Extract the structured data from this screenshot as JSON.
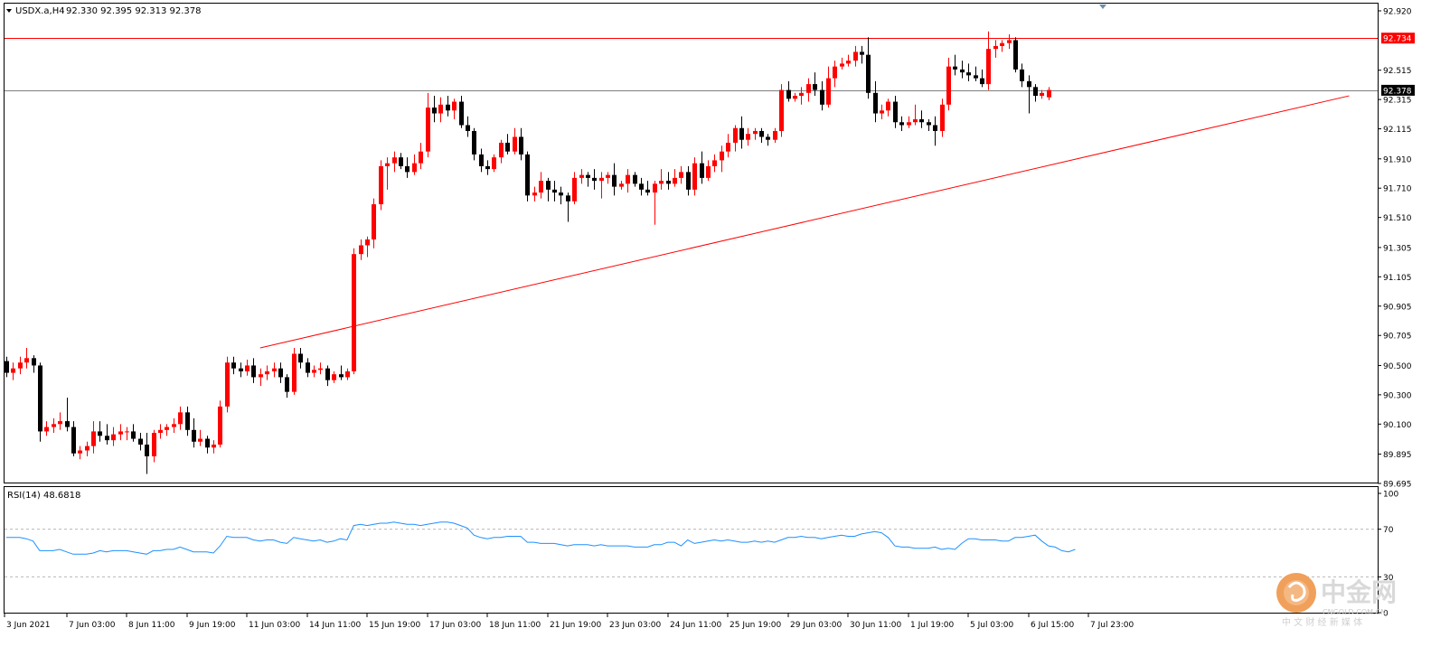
{
  "chart_header": {
    "symbol_timeframe": "USDX.a,H4",
    "ohlc": "92.330 92.395 92.313 92.378"
  },
  "rsi_label": "RSI(14) 48.6818",
  "price_axis": {
    "ticks": [
      "92.920",
      "92.515",
      "92.315",
      "92.115",
      "91.910",
      "91.710",
      "91.510",
      "91.305",
      "91.105",
      "90.905",
      "90.705",
      "90.500",
      "90.300",
      "90.100",
      "89.895",
      "89.695"
    ],
    "marker_red": "92.734",
    "marker_current": "92.378"
  },
  "rsi_axis": {
    "ticks": [
      "100",
      "70",
      "30",
      "0"
    ]
  },
  "time_axis": {
    "labels": [
      "3 Jun 2021",
      "7 Jun 03:00",
      "8 Jun 11:00",
      "9 Jun 19:00",
      "11 Jun 03:00",
      "14 Jun 11:00",
      "15 Jun 19:00",
      "17 Jun 03:00",
      "18 Jun 11:00",
      "21 Jun 19:00",
      "23 Jun 03:00",
      "24 Jun 11:00",
      "25 Jun 19:00",
      "29 Jun 03:00",
      "30 Jun 11:00",
      "1 Jul 19:00",
      "5 Jul 03:00",
      "6 Jul 15:00",
      "7 Jul 23:00"
    ]
  },
  "watermark": {
    "chinese": "中金网",
    "domain": "CNGOLD.COM.CN",
    "tagline": "中 文 财 经 新 媒 体"
  },
  "colors": {
    "bull": "#ff0000",
    "bear": "#000000",
    "trendline": "#ff0000",
    "rsi_line": "#1e90ff",
    "logo_orange": "#f0a05a"
  },
  "chart_data": {
    "type": "candlestick",
    "symbol": "USDX.a",
    "timeframe": "H4",
    "ylim": [
      89.695,
      92.92
    ],
    "rsi_ylim": [
      0,
      100
    ],
    "rsi_levels": [
      70,
      30
    ],
    "horizontal_lines": [
      {
        "price": 92.734,
        "color": "#ff0000"
      },
      {
        "price": 92.378,
        "color": "#808080"
      }
    ],
    "trendline": [
      {
        "x_index": 38,
        "price": 90.62
      },
      {
        "x_index": 201,
        "price": 92.34
      }
    ],
    "candles": [
      [
        90.53,
        90.56,
        90.42,
        90.45
      ],
      [
        90.45,
        90.52,
        90.4,
        90.48
      ],
      [
        90.48,
        90.56,
        90.44,
        90.52
      ],
      [
        90.52,
        90.62,
        90.48,
        90.55
      ],
      [
        90.55,
        90.57,
        90.45,
        90.5
      ],
      [
        90.5,
        90.52,
        89.98,
        90.05
      ],
      [
        90.05,
        90.12,
        90.02,
        90.08
      ],
      [
        90.08,
        90.14,
        90.04,
        90.1
      ],
      [
        90.1,
        90.18,
        90.06,
        90.12
      ],
      [
        90.12,
        90.28,
        90.05,
        90.08
      ],
      [
        90.08,
        90.12,
        89.88,
        89.9
      ],
      [
        89.9,
        89.95,
        89.86,
        89.92
      ],
      [
        89.92,
        89.98,
        89.88,
        89.95
      ],
      [
        89.95,
        90.12,
        89.9,
        90.05
      ],
      [
        90.05,
        90.12,
        89.98,
        90.02
      ],
      [
        90.02,
        90.1,
        89.96,
        89.99
      ],
      [
        89.99,
        90.08,
        89.95,
        90.03
      ],
      [
        90.03,
        90.1,
        89.99,
        90.05
      ],
      [
        90.05,
        90.08,
        89.99,
        90.05
      ],
      [
        90.05,
        90.1,
        89.98,
        90.0
      ],
      [
        90.0,
        90.04,
        89.92,
        89.96
      ],
      [
        89.96,
        90.04,
        89.76,
        89.88
      ],
      [
        89.88,
        90.06,
        89.84,
        90.04
      ],
      [
        90.04,
        90.1,
        90.0,
        90.06
      ],
      [
        90.06,
        90.1,
        90.02,
        90.08
      ],
      [
        90.08,
        90.14,
        90.04,
        90.1
      ],
      [
        90.1,
        90.22,
        90.06,
        90.18
      ],
      [
        90.18,
        90.22,
        90.02,
        90.06
      ],
      [
        90.06,
        90.14,
        89.94,
        89.98
      ],
      [
        89.98,
        90.06,
        89.95,
        90.0
      ],
      [
        90.0,
        90.02,
        89.9,
        89.94
      ],
      [
        89.94,
        89.99,
        89.9,
        89.96
      ],
      [
        89.96,
        90.26,
        89.94,
        90.22
      ],
      [
        90.22,
        90.56,
        90.18,
        90.52
      ],
      [
        90.52,
        90.56,
        90.44,
        90.48
      ],
      [
        90.48,
        90.52,
        90.42,
        90.46
      ],
      [
        90.46,
        90.54,
        90.43,
        90.5
      ],
      [
        90.5,
        90.55,
        90.38,
        90.42
      ],
      [
        90.42,
        90.48,
        90.36,
        90.44
      ],
      [
        90.44,
        90.5,
        90.4,
        90.46
      ],
      [
        90.46,
        90.52,
        90.42,
        90.48
      ],
      [
        90.48,
        90.52,
        90.38,
        90.42
      ],
      [
        90.42,
        90.44,
        90.28,
        90.32
      ],
      [
        90.32,
        90.62,
        90.3,
        90.58
      ],
      [
        90.58,
        90.62,
        90.48,
        90.52
      ],
      [
        90.52,
        90.55,
        90.42,
        90.45
      ],
      [
        90.45,
        90.5,
        90.42,
        90.47
      ],
      [
        90.47,
        90.52,
        90.44,
        90.48
      ],
      [
        90.48,
        90.5,
        90.36,
        90.4
      ],
      [
        90.4,
        90.46,
        90.38,
        90.44
      ],
      [
        90.44,
        90.5,
        90.4,
        90.42
      ],
      [
        90.42,
        90.48,
        90.4,
        90.46
      ],
      [
        90.46,
        91.3,
        90.44,
        91.26
      ],
      [
        91.26,
        91.36,
        91.22,
        91.32
      ],
      [
        91.32,
        91.38,
        91.24,
        91.36
      ],
      [
        91.36,
        91.64,
        91.3,
        91.6
      ],
      [
        91.6,
        91.9,
        91.56,
        91.86
      ],
      [
        91.86,
        91.92,
        91.7,
        91.88
      ],
      [
        91.88,
        91.96,
        91.82,
        91.92
      ],
      [
        91.92,
        91.95,
        91.84,
        91.86
      ],
      [
        91.86,
        91.92,
        91.78,
        91.82
      ],
      [
        91.82,
        91.94,
        91.8,
        91.88
      ],
      [
        91.88,
        92.02,
        91.84,
        91.96
      ],
      [
        91.96,
        92.36,
        91.92,
        92.26
      ],
      [
        92.26,
        92.34,
        92.16,
        92.22
      ],
      [
        92.22,
        92.33,
        92.16,
        92.28
      ],
      [
        92.28,
        92.34,
        92.2,
        92.24
      ],
      [
        92.24,
        92.32,
        92.18,
        92.3
      ],
      [
        92.3,
        92.34,
        92.12,
        92.14
      ],
      [
        92.14,
        92.2,
        92.06,
        92.1
      ],
      [
        92.1,
        92.12,
        91.9,
        91.94
      ],
      [
        91.94,
        91.98,
        91.82,
        91.86
      ],
      [
        91.86,
        91.9,
        91.8,
        91.84
      ],
      [
        91.84,
        91.94,
        91.82,
        91.92
      ],
      [
        91.92,
        92.04,
        91.88,
        92.02
      ],
      [
        92.02,
        92.08,
        91.94,
        91.96
      ],
      [
        91.96,
        92.12,
        91.94,
        92.06
      ],
      [
        92.06,
        92.12,
        91.9,
        91.94
      ],
      [
        91.94,
        91.96,
        91.62,
        91.66
      ],
      [
        91.66,
        91.72,
        91.62,
        91.68
      ],
      [
        91.68,
        91.82,
        91.64,
        91.76
      ],
      [
        91.76,
        91.78,
        91.62,
        91.7
      ],
      [
        91.7,
        91.76,
        91.62,
        91.68
      ],
      [
        91.68,
        91.72,
        91.6,
        91.66
      ],
      [
        91.66,
        91.68,
        91.48,
        91.62
      ],
      [
        91.62,
        91.82,
        91.6,
        91.78
      ],
      [
        91.78,
        91.84,
        91.74,
        91.8
      ],
      [
        91.8,
        91.82,
        91.72,
        91.78
      ],
      [
        91.78,
        91.84,
        91.7,
        91.76
      ],
      [
        91.76,
        91.82,
        91.64,
        91.78
      ],
      [
        91.78,
        91.82,
        91.74,
        91.8
      ],
      [
        91.8,
        91.88,
        91.66,
        91.72
      ],
      [
        91.72,
        91.76,
        91.7,
        91.74
      ],
      [
        91.74,
        91.84,
        91.68,
        91.8
      ],
      [
        91.8,
        91.82,
        91.72,
        91.74
      ],
      [
        91.74,
        91.78,
        91.66,
        91.7
      ],
      [
        91.7,
        91.76,
        91.66,
        91.68
      ],
      [
        91.68,
        91.76,
        91.46,
        91.74
      ],
      [
        91.74,
        91.84,
        91.7,
        91.76
      ],
      [
        91.76,
        91.82,
        91.7,
        91.74
      ],
      [
        91.74,
        91.84,
        91.72,
        91.78
      ],
      [
        91.78,
        91.86,
        91.74,
        91.82
      ],
      [
        91.82,
        91.86,
        91.66,
        91.7
      ],
      [
        91.7,
        91.92,
        91.66,
        91.88
      ],
      [
        91.88,
        91.96,
        91.74,
        91.78
      ],
      [
        91.78,
        91.9,
        91.76,
        91.86
      ],
      [
        91.86,
        91.94,
        91.82,
        91.9
      ],
      [
        91.9,
        92.0,
        91.82,
        91.96
      ],
      [
        91.96,
        92.08,
        91.92,
        92.02
      ],
      [
        92.02,
        92.14,
        91.96,
        92.12
      ],
      [
        92.12,
        92.2,
        91.98,
        92.04
      ],
      [
        92.04,
        92.12,
        92.0,
        92.08
      ],
      [
        92.08,
        92.12,
        92.04,
        92.1
      ],
      [
        92.1,
        92.12,
        92.02,
        92.06
      ],
      [
        92.06,
        92.08,
        92.0,
        92.04
      ],
      [
        92.04,
        92.12,
        92.02,
        92.1
      ],
      [
        92.1,
        92.42,
        92.06,
        92.38
      ],
      [
        92.38,
        92.44,
        92.3,
        92.32
      ],
      [
        92.32,
        92.36,
        92.3,
        92.34
      ],
      [
        92.34,
        92.4,
        92.28,
        92.36
      ],
      [
        92.36,
        92.46,
        92.3,
        92.42
      ],
      [
        92.42,
        92.5,
        92.34,
        92.38
      ],
      [
        92.38,
        92.44,
        92.24,
        92.28
      ],
      [
        92.28,
        92.54,
        92.26,
        92.46
      ],
      [
        92.46,
        92.58,
        92.4,
        92.54
      ],
      [
        92.54,
        92.6,
        92.52,
        92.56
      ],
      [
        92.56,
        92.62,
        92.54,
        92.58
      ],
      [
        92.58,
        92.68,
        92.54,
        92.64
      ],
      [
        92.64,
        92.68,
        92.56,
        92.62
      ],
      [
        92.62,
        92.74,
        92.32,
        92.36
      ],
      [
        92.36,
        92.44,
        92.16,
        92.22
      ],
      [
        92.22,
        92.28,
        92.18,
        92.24
      ],
      [
        92.24,
        92.32,
        92.2,
        92.3
      ],
      [
        92.3,
        92.34,
        92.12,
        92.16
      ],
      [
        92.16,
        92.2,
        92.1,
        92.14
      ],
      [
        92.14,
        92.2,
        92.12,
        92.16
      ],
      [
        92.16,
        92.28,
        92.14,
        92.18
      ],
      [
        92.18,
        92.24,
        92.12,
        92.16
      ],
      [
        92.16,
        92.18,
        92.1,
        92.14
      ],
      [
        92.14,
        92.2,
        92.0,
        92.1
      ],
      [
        92.1,
        92.32,
        92.06,
        92.28
      ],
      [
        92.28,
        92.6,
        92.24,
        92.54
      ],
      [
        92.54,
        92.62,
        92.48,
        92.52
      ],
      [
        92.52,
        92.58,
        92.46,
        92.5
      ],
      [
        92.5,
        92.56,
        92.44,
        92.48
      ],
      [
        92.48,
        92.54,
        92.44,
        92.46
      ],
      [
        92.46,
        92.52,
        92.4,
        92.42
      ],
      [
        92.42,
        92.78,
        92.38,
        92.66
      ],
      [
        92.66,
        92.72,
        92.6,
        92.68
      ],
      [
        92.68,
        92.72,
        92.64,
        92.7
      ],
      [
        92.7,
        92.76,
        92.66,
        92.72
      ],
      [
        92.72,
        92.74,
        92.5,
        92.52
      ],
      [
        92.52,
        92.56,
        92.4,
        92.44
      ],
      [
        92.44,
        92.48,
        92.22,
        92.4
      ],
      [
        92.4,
        92.42,
        92.3,
        92.34
      ],
      [
        92.34,
        92.38,
        92.32,
        92.36
      ],
      [
        92.33,
        92.4,
        92.31,
        92.38
      ]
    ],
    "rsi": [
      63,
      63,
      63,
      62,
      60,
      52,
      52,
      52,
      53,
      51,
      49,
      49,
      49,
      50,
      52,
      51,
      52,
      52,
      52,
      51,
      50,
      49,
      52,
      52,
      53,
      53,
      55,
      53,
      51,
      51,
      51,
      50,
      56,
      64,
      63,
      63,
      63,
      61,
      60,
      61,
      61,
      59,
      58,
      63,
      62,
      61,
      60,
      61,
      59,
      60,
      62,
      61,
      73,
      74,
      73,
      74,
      75,
      75,
      76,
      75,
      74,
      74,
      73,
      74,
      75,
      76,
      76,
      75,
      73,
      71,
      65,
      63,
      62,
      63,
      63,
      64,
      64,
      64,
      59,
      59,
      58,
      58,
      58,
      57,
      56,
      57,
      57,
      57,
      56,
      57,
      56,
      56,
      56,
      56,
      55,
      55,
      55,
      57,
      57,
      59,
      59,
      56,
      61,
      58,
      59,
      60,
      61,
      60,
      61,
      60,
      59,
      59,
      60,
      59,
      60,
      59,
      61,
      63,
      63,
      64,
      63,
      63,
      62,
      63,
      64,
      65,
      64,
      64,
      66,
      67,
      68,
      67,
      63,
      56,
      55,
      55,
      54,
      54,
      54,
      55,
      53,
      54,
      53,
      58,
      62,
      62,
      61,
      61,
      61,
      60,
      60,
      63,
      63,
      64,
      65,
      60,
      56,
      55,
      52,
      51,
      53
    ]
  }
}
